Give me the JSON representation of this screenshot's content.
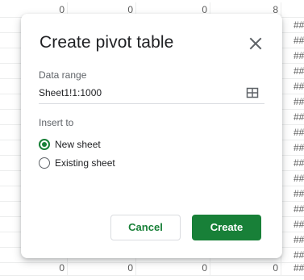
{
  "sheet": {
    "rows": [
      [
        "0",
        "0",
        "0",
        "8",
        ""
      ],
      [
        "",
        "",
        "",
        "",
        "##"
      ],
      [
        "",
        "",
        "",
        "",
        "##"
      ],
      [
        "",
        "",
        "",
        "",
        "##"
      ],
      [
        "",
        "",
        "",
        "",
        "##"
      ],
      [
        "",
        "",
        "",
        "",
        "##"
      ],
      [
        "",
        "",
        "",
        "",
        "##"
      ],
      [
        "",
        "",
        "",
        "",
        "##"
      ],
      [
        "",
        "",
        "",
        "",
        "##"
      ],
      [
        "",
        "",
        "",
        "",
        "##"
      ],
      [
        "",
        "",
        "",
        "",
        "##"
      ],
      [
        "",
        "",
        "",
        "",
        "##"
      ],
      [
        "",
        "",
        "",
        "",
        "##"
      ],
      [
        "",
        "",
        "",
        "",
        "##"
      ],
      [
        "",
        "",
        "",
        "",
        "##"
      ],
      [
        "",
        "",
        "",
        "",
        "##"
      ],
      [
        "",
        "",
        "",
        "",
        "##"
      ],
      [
        "0",
        "0",
        "0",
        "0",
        "##"
      ]
    ]
  },
  "dialog": {
    "title": "Create pivot table",
    "close_icon": "close-icon",
    "data_range_label": "Data range",
    "data_range_value": "Sheet1!1:1000",
    "range_icon": "grid-select-icon",
    "insert_to_label": "Insert to",
    "options": [
      {
        "label": "New sheet",
        "selected": true
      },
      {
        "label": "Existing sheet",
        "selected": false
      }
    ],
    "cancel_label": "Cancel",
    "create_label": "Create",
    "accent_color": "#188038"
  }
}
